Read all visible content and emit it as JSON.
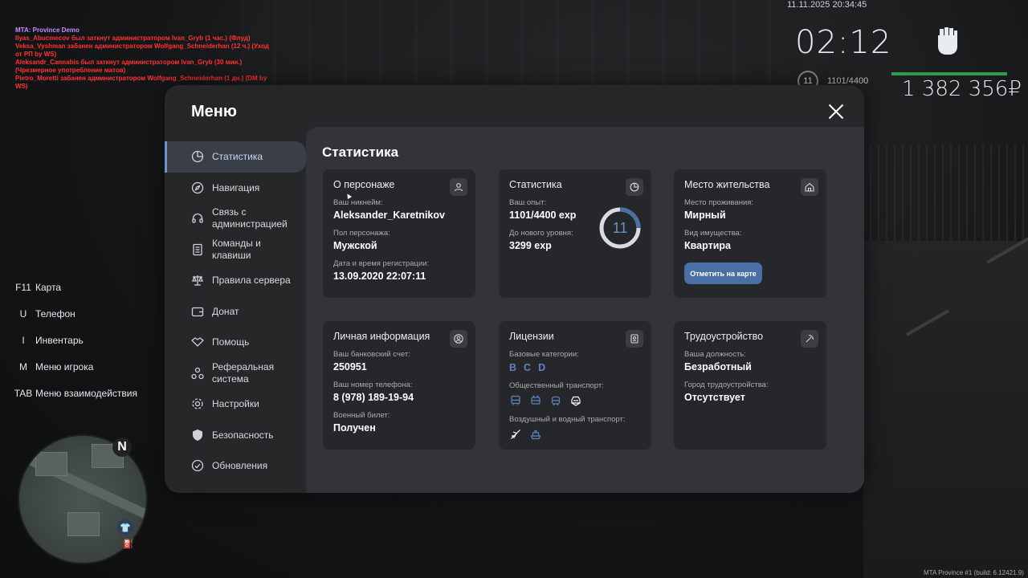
{
  "hud": {
    "datetime": "11.11.2025 20:34:45",
    "clock": "02:12",
    "level": "11",
    "exp": "1101/4400",
    "money": "1 382 356₽",
    "build": "MTA Province #1 (build: 6.12421.9)"
  },
  "chat": {
    "title": "MTA: Province Demo",
    "lines": [
      "Ilyas_Abucmecov был заткнут администратором Ivan_Gryb (1 час.) (Флуд)",
      "Veksa_Vyshman забанен администратором Wolfgang_Schneiderhan (12 ч.) (Уход от РП by WS)",
      "Aleksandr_Cannabis был заткнут администратором Ivan_Gryb (30 мин.) (Чрезмерное употребление матов)",
      "Pietro_Moretti забанен администратором Wolfgang_Schneiderhan (1 дн.) (DM by WS)"
    ]
  },
  "binds": [
    {
      "key": "F11",
      "label": "Карта"
    },
    {
      "key": "U",
      "label": "Телефон"
    },
    {
      "key": "I",
      "label": "Инвентарь"
    },
    {
      "key": "M",
      "label": "Меню игрока"
    },
    {
      "key": "TAB",
      "label": "Меню взаимодействия"
    }
  ],
  "minimap": {
    "north": "N"
  },
  "menu": {
    "title": "Меню",
    "sidebar": [
      {
        "label": "Статистика",
        "icon": "pie-chart-icon",
        "active": true
      },
      {
        "label": "Навигация",
        "icon": "compass-icon"
      },
      {
        "label": "Связь с администрацией",
        "icon": "headset-icon"
      },
      {
        "label": "Команды и клавиши",
        "icon": "document-icon"
      },
      {
        "label": "Правила сервера",
        "icon": "scales-icon"
      },
      {
        "label": "Донат",
        "icon": "wallet-icon"
      },
      {
        "label": "Помощь",
        "icon": "handshake-icon"
      },
      {
        "label": "Реферальная система",
        "icon": "referral-icon"
      },
      {
        "label": "Настройки",
        "icon": "gear-icon"
      },
      {
        "label": "Безопасность",
        "icon": "shield-icon"
      },
      {
        "label": "Обновления",
        "icon": "update-icon"
      }
    ],
    "content_title": "Статистика",
    "character": {
      "title": "О персонаже",
      "nick_label": "Ваш никнейм:",
      "nick": "Aleksander_Karetnikov",
      "sex_label": "Пол персонажа:",
      "sex": "Мужской",
      "reg_label": "Дата и время регистрации:",
      "reg": "13.09.2020 22:07:11"
    },
    "stats": {
      "title": "Статистика",
      "exp_label": "Ваш опыт:",
      "exp": "1101/4400 exp",
      "next_label": "До нового уровня:",
      "next": "3299 exp",
      "level": "11",
      "progress": 0.25
    },
    "residence": {
      "title": "Место жительства",
      "place_label": "Место проживания:",
      "place": "Мирный",
      "type_label": "Вид имущества:",
      "type": "Квартира",
      "button": "Отметить на карте"
    },
    "personal": {
      "title": "Личная информация",
      "bank_label": "Ваш банковский счет:",
      "bank": "250951",
      "phone_label": "Ваш номер телефона:",
      "phone": "8 (978) 189-19-94",
      "military_label": "Военный билет:",
      "military": "Получен"
    },
    "licenses": {
      "title": "Лицензии",
      "base_label": "Базовые категории:",
      "base": [
        "B",
        "C",
        "D"
      ],
      "public_label": "Общественный транспорт:",
      "air_label": "Воздушный и водный транспорт:"
    },
    "job": {
      "title": "Трудоустройство",
      "pos_label": "Ваша должность:",
      "pos": "Безработный",
      "city_label": "Город трудоустройства:",
      "city": "Отсутствует"
    }
  }
}
